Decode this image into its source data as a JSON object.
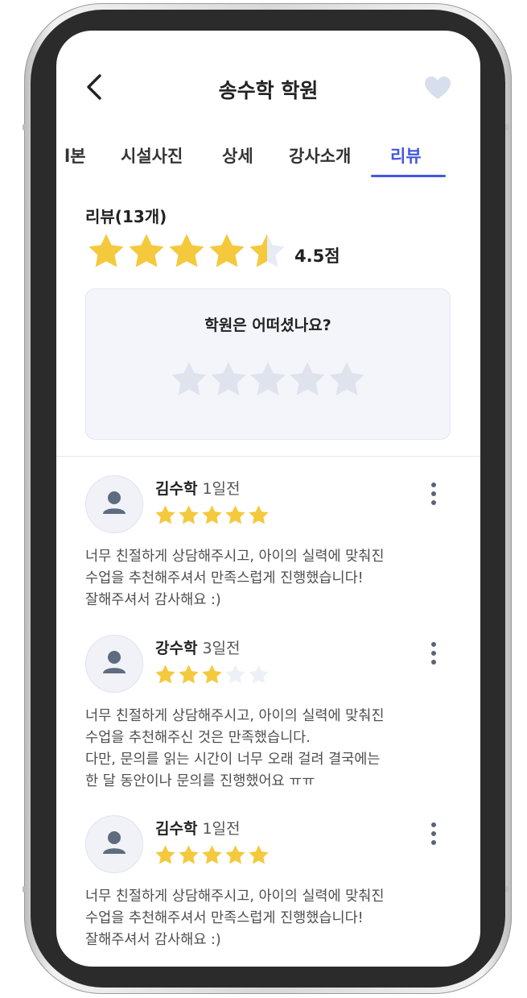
{
  "header": {
    "title": "송수학 학원",
    "back_icon": "chevron-left-icon",
    "favorite_icon": "heart-icon"
  },
  "tabs": [
    {
      "label": "l본",
      "active": false
    },
    {
      "label": "시설사진",
      "active": false
    },
    {
      "label": "상세",
      "active": false
    },
    {
      "label": "강사소개",
      "active": false
    },
    {
      "label": "리뷰",
      "active": true
    }
  ],
  "summary": {
    "count_label": "리뷰(13개)",
    "rating": 4.5,
    "score_label": "4.5점"
  },
  "ask": {
    "question": "학원은 어떠셨나요?",
    "stars": 5
  },
  "reviews": [
    {
      "author": "김수학",
      "time": "1일전",
      "rating": 5,
      "lines": [
        "너무 친절하게 상담해주시고, 아이의 실력에 맞춰진",
        "수업을 추천해주셔서 만족스럽게 진행했습니다!",
        "잘해주셔서 감사해요 :)"
      ]
    },
    {
      "author": "강수학",
      "time": "3일전",
      "rating": 3,
      "lines": [
        "너무 친절하게 상담해주시고, 아이의 실력에 맞춰진",
        "수업을 추천해주신 것은 만족했습니다.",
        "다만, 문의를 읽는 시간이 너무 오래 걸려 결국에는",
        "한 달 동안이나 문의를 진행했어요 ㅠㅠ"
      ]
    },
    {
      "author": "김수학",
      "time": "1일전",
      "rating": 5,
      "lines": [
        "너무 친절하게 상담해주시고, 아이의 실력에 맞춰진",
        "수업을 추천해주셔서 만족스럽게 진행했습니다!",
        "잘해주셔서 감사해요 :)"
      ]
    }
  ],
  "colors": {
    "accent": "#4257e0",
    "star_filled": "#f5c93d",
    "star_empty": "#dfe3ee",
    "heart": "#d7deed"
  }
}
